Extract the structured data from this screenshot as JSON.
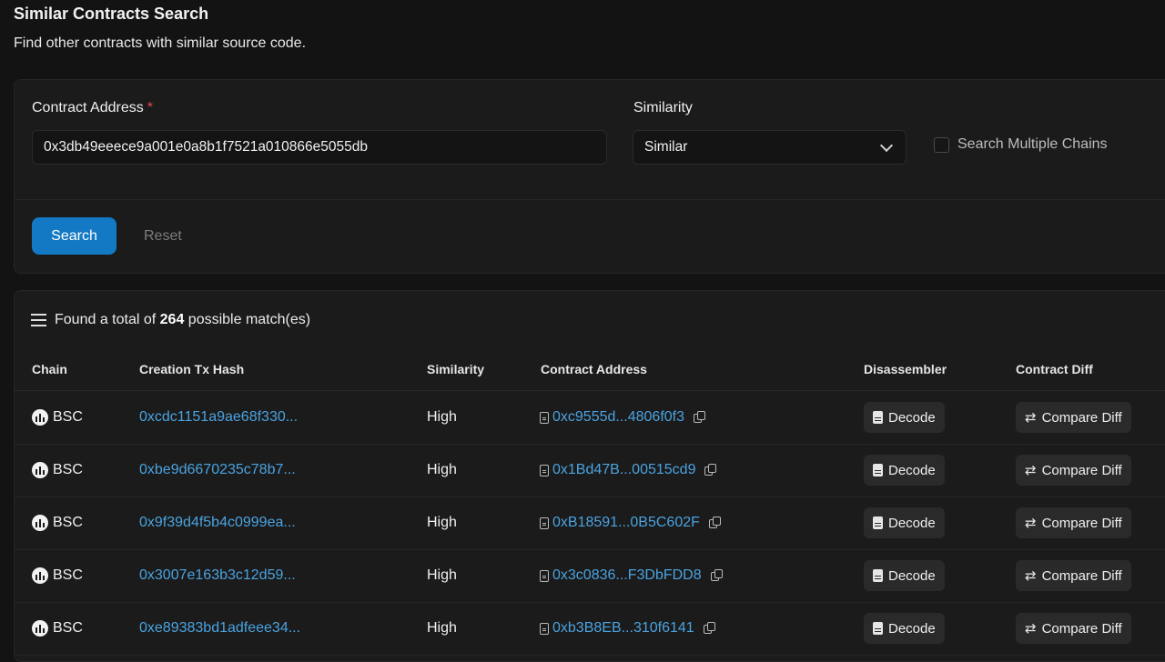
{
  "header": {
    "title": "Similar Contracts Search",
    "subtitle": "Find other contracts with similar source code."
  },
  "form": {
    "address_label": "Contract Address",
    "required_mark": "*",
    "address_value": "0x3db49eeece9a001e0a8b1f7521a010866e5055db",
    "similarity_label": "Similarity",
    "similarity_value": "Similar",
    "multi_chain_label": "Search Multiple Chains",
    "multi_chain_checked": false,
    "search_button": "Search",
    "reset_button": "Reset"
  },
  "results": {
    "found_prefix": "Found a total of",
    "found_count": "264",
    "found_suffix": "possible match(es)",
    "columns": [
      "Chain",
      "Creation Tx Hash",
      "Similarity",
      "Contract Address",
      "Disassembler",
      "Contract Diff"
    ],
    "rows": [
      {
        "chain": "BSC",
        "tx_hash": "0xcdc1151a9ae68f330...",
        "similarity": "High",
        "address": "0xc9555d...4806f0f3",
        "decode": "Decode",
        "diff": "Compare Diff"
      },
      {
        "chain": "BSC",
        "tx_hash": "0xbe9d6670235c78b7...",
        "similarity": "High",
        "address": "0x1Bd47B...00515cd9",
        "decode": "Decode",
        "diff": "Compare Diff"
      },
      {
        "chain": "BSC",
        "tx_hash": "0x9f39d4f5b4c0999ea...",
        "similarity": "High",
        "address": "0xB18591...0B5C602F",
        "decode": "Decode",
        "diff": "Compare Diff"
      },
      {
        "chain": "BSC",
        "tx_hash": "0x3007e163b3c12d59...",
        "similarity": "High",
        "address": "0x3c0836...F3DbFDD8",
        "decode": "Decode",
        "diff": "Compare Diff"
      },
      {
        "chain": "BSC",
        "tx_hash": "0xe89383bd1adfeee34...",
        "similarity": "High",
        "address": "0xb3B8EB...310f6141",
        "decode": "Decode",
        "diff": "Compare Diff"
      }
    ]
  },
  "icons": {
    "list": "list-icon",
    "chain": "bsc-chain-icon",
    "document": "document-icon",
    "copy": "copy-icon",
    "decode": "file-icon",
    "diff": "swap-arrows-icon"
  },
  "colors": {
    "background": "#131313",
    "card": "#1b1b1b",
    "accent": "#1479c4",
    "link": "#4aa3e0",
    "required": "#e5484d"
  }
}
